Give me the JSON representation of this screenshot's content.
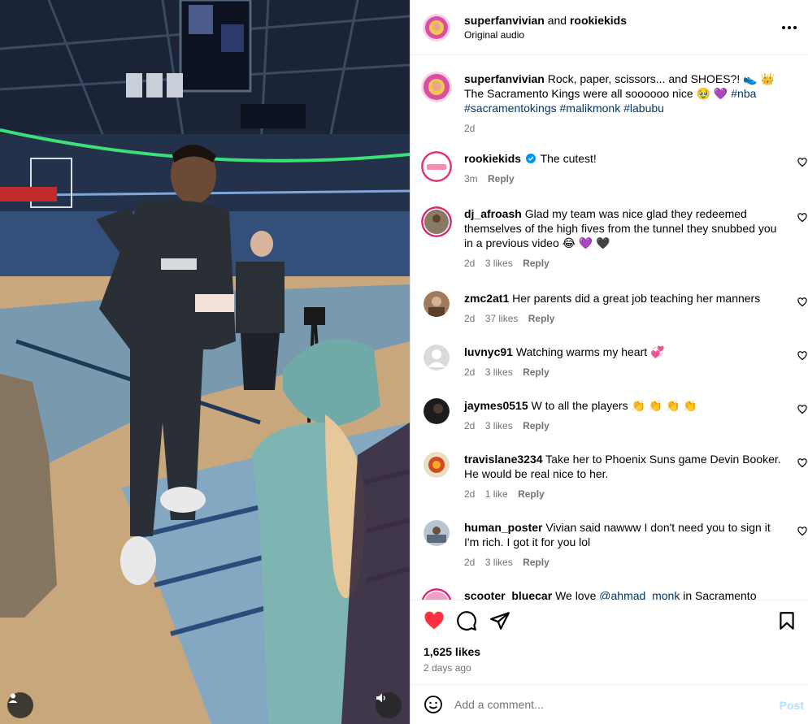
{
  "header": {
    "user1": "superfanvivian",
    "and_text": "and",
    "user2": "rookiekids",
    "audio": "Original audio"
  },
  "caption": {
    "username": "superfanvivian",
    "text_1": "Rock, paper, scissors... and SHOES?! 👟 👑 The Sacramento Kings were all soooooo nice 🥹 💜",
    "hashtags": [
      "#nba",
      "#sacramentokings",
      "#malikmonk",
      "#labubu"
    ],
    "time": "2d"
  },
  "comments": [
    {
      "username": "rookiekids",
      "verified": true,
      "text": "The cutest!",
      "time": "3m",
      "likes": "",
      "reply": "Reply"
    },
    {
      "username": "dj_afroash",
      "verified": false,
      "text": "Glad my team was nice glad they redeemed themselves of the high fives from the tunnel they snubbed you in a previous video 😂 💜 🖤",
      "time": "2d",
      "likes": "3 likes",
      "reply": "Reply"
    },
    {
      "username": "zmc2at1",
      "verified": false,
      "text": "Her parents did a great job teaching her manners",
      "time": "2d",
      "likes": "37 likes",
      "reply": "Reply"
    },
    {
      "username": "luvnyc91",
      "verified": false,
      "text": "Watching warms my heart 💞",
      "time": "2d",
      "likes": "3 likes",
      "reply": "Reply"
    },
    {
      "username": "jaymes0515",
      "verified": false,
      "text": "W to all the players 👏 👏 👏 👏",
      "time": "2d",
      "likes": "3 likes",
      "reply": "Reply"
    },
    {
      "username": "travislane3234",
      "verified": false,
      "text": "Take her to Phoenix Suns game Devin Booker. He would be real nice to her.",
      "time": "2d",
      "likes": "1 like",
      "reply": "Reply"
    },
    {
      "username": "human_poster",
      "verified": false,
      "text": "Vivian said nawww I don't need you to sign it I'm rich. I got it for you lol",
      "time": "2d",
      "likes": "3 likes",
      "reply": "Reply"
    },
    {
      "username": "scooter_bluecar",
      "verified": false,
      "text_before": "We love",
      "mention": "@ahmad_monk",
      "text_after": "in Sacramento",
      "time": "",
      "likes": "",
      "reply": ""
    }
  ],
  "actions": {
    "likes": "1,625 likes",
    "ago": "2 days ago"
  },
  "add_comment": {
    "placeholder": "Add a comment...",
    "post_label": "Post"
  },
  "colors": {
    "like_red": "#ff3040",
    "link_blue": "#00376b",
    "post_disabled": "#b2dffc",
    "verified_blue": "#0095f6"
  },
  "icons": {
    "like": "heart-filled-icon",
    "comment": "comment-bubble-icon",
    "share": "paper-plane-icon",
    "save": "bookmark-icon",
    "emoji": "smiley-icon",
    "more": "ellipsis-icon",
    "mute": "speaker-icon",
    "tags": "user-tag-icon"
  }
}
